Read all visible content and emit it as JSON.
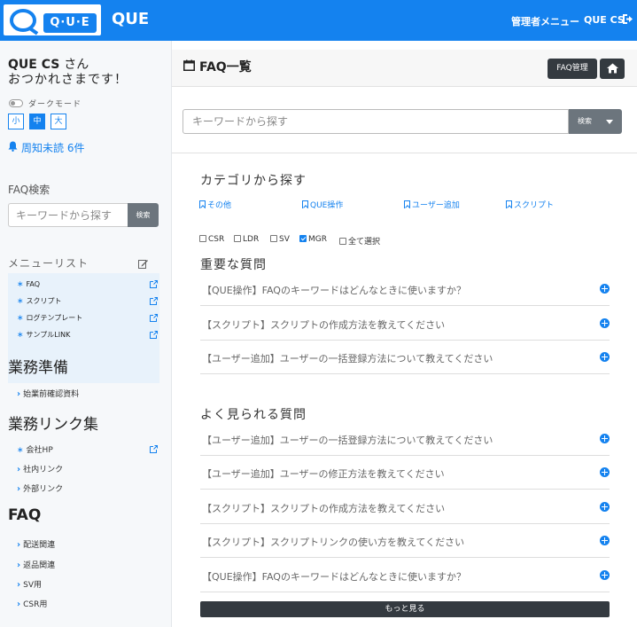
{
  "header": {
    "logo_text": "Q·U·E",
    "brand": "QUE",
    "admin_menu": "管理者メニュー",
    "user": "QUE CS",
    "logout_icon": "sign-out-icon",
    "bg_color": "#1482ef"
  },
  "sidebar": {
    "greeting_name": "QUE CS",
    "greeting_suffix": "さん",
    "greeting_line2": "おつかれさまです！",
    "dark_mode_label": "ダークモード",
    "dark_mode_on": false,
    "font_sizes": [
      "小",
      "中",
      "大"
    ],
    "font_size_selected": "中",
    "unread_notice": "周知未読 6件",
    "faq_search_title": "FAQ検索",
    "faq_search_placeholder": "キーワードから探す",
    "faq_search_button": "検索",
    "menu_list_title": "メニューリスト",
    "menu_items": [
      {
        "label": "FAQ"
      },
      {
        "label": "スクリプト"
      },
      {
        "label": "ログテンプレート"
      },
      {
        "label": "サンプルLINK"
      }
    ],
    "prep_title": "業務準備",
    "prep_items": [
      "始業前確認資料"
    ],
    "links_title": "業務リンク集",
    "link_items": [
      {
        "label": "会社HP",
        "type": "star"
      },
      {
        "label": "社内リンク",
        "type": "chevron"
      },
      {
        "label": "外部リンク",
        "type": "chevron"
      }
    ],
    "faq_title": "FAQ",
    "faq_items": [
      "配送関連",
      "返品関連",
      "SV用",
      "CSR用"
    ]
  },
  "main": {
    "title": "FAQ一覧",
    "faq_admin_button": "FAQ管理",
    "search_placeholder": "キーワードから探す",
    "search_button": "検索",
    "category_title": "カテゴリから探す",
    "categories": [
      "その他",
      "QUE操作",
      "ユーザー追加",
      "スクリプト"
    ],
    "filters": [
      {
        "label": "CSR",
        "checked": false
      },
      {
        "label": "LDR",
        "checked": false
      },
      {
        "label": "SV",
        "checked": false
      },
      {
        "label": "MGR",
        "checked": true
      },
      {
        "label": "全て選択",
        "checked": false
      }
    ],
    "important_title": "重要な質問",
    "important_questions": [
      "【QUE操作】FAQのキーワードはどんなときに使いますか？",
      "【スクリプト】スクリプトの作成方法を教えてください",
      "【ユーザー追加】ユーザーの一括登録方法について教えてください"
    ],
    "popular_title": "よく見られる質問",
    "popular_questions": [
      "【ユーザー追加】ユーザーの一括登録方法について教えてください",
      "【ユーザー追加】ユーザーの修正方法を教えてください",
      "【スクリプト】スクリプトの作成方法を教えてください",
      "【スクリプト】スクリプトリンクの使い方を教えてください",
      "【QUE操作】FAQのキーワードはどんなときに使いますか？"
    ],
    "more_button": "もっと見る"
  }
}
